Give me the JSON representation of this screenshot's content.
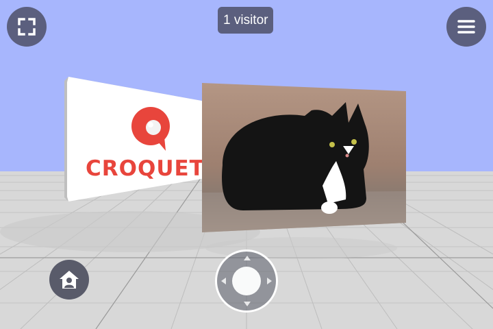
{
  "visitors": {
    "label": "1 visitor"
  },
  "logo_card": {
    "brand_text": "CROQUET"
  },
  "icons": {
    "fullscreen": "fullscreen-icon",
    "menu": "hamburger-menu-icon",
    "home": "home-user-icon",
    "joystick": "joystick-icon"
  },
  "colors": {
    "sky": "#a7b6fd",
    "floor": "#d9d9d9",
    "button_bg": "#5b5f7e",
    "brand_red": "#e8453c"
  }
}
